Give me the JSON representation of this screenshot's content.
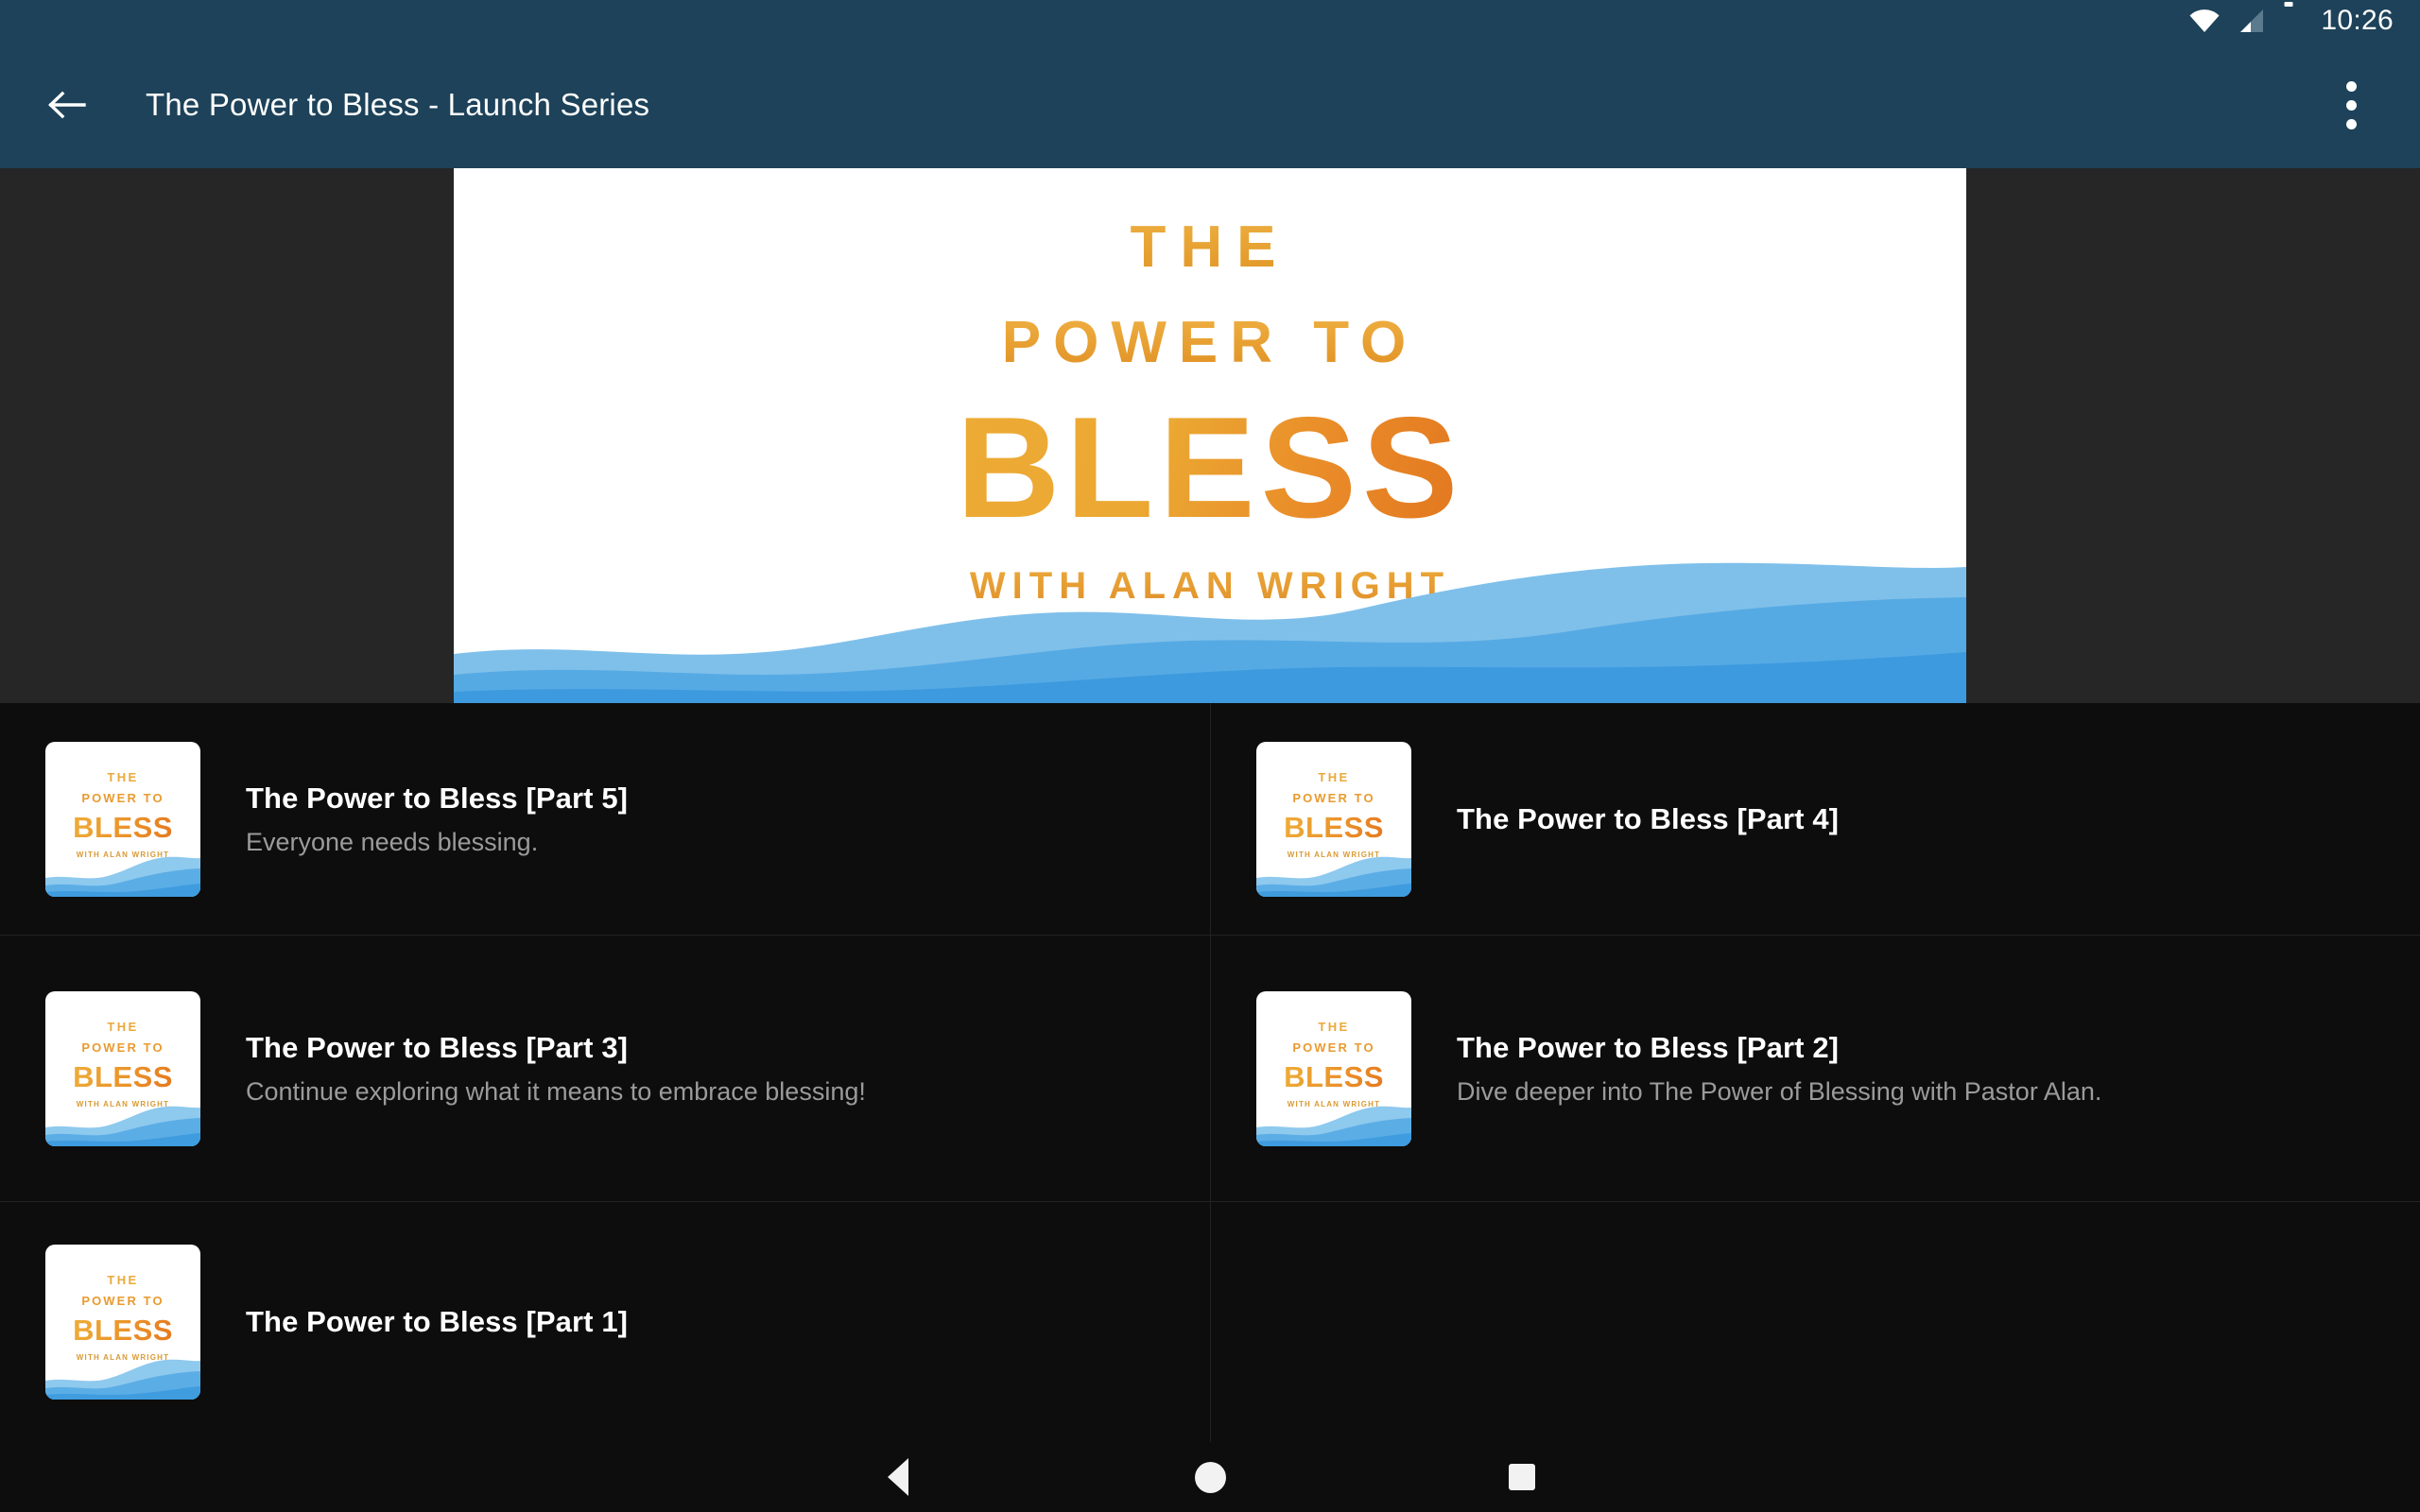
{
  "status_bar": {
    "time": "10:26",
    "icons": [
      "wifi-icon",
      "cellular-signal-icon",
      "battery-icon"
    ]
  },
  "app_bar": {
    "back_icon": "back-arrow-icon",
    "title": "The Power to Bless - Launch Series",
    "overflow_icon": "more-vertical-icon",
    "background_color": "#1d4259"
  },
  "hero": {
    "line1": "THE",
    "line2": "POWER TO",
    "line3": "BLESS",
    "line4": "WITH ALAN WRIGHT",
    "accent_color": "#e89a2c",
    "wave_color": "#4aa3e0",
    "background_color": "#ffffff"
  },
  "thumbnail": {
    "line1": "THE",
    "line2": "POWER TO",
    "line3": "BLESS",
    "line4": "WITH ALAN WRIGHT"
  },
  "episodes": [
    {
      "title": "The Power to Bless [Part 5]",
      "subtitle": "Everyone needs blessing."
    },
    {
      "title": "The Power to Bless [Part 4]",
      "subtitle": ""
    },
    {
      "title": "The Power to Bless [Part 3]",
      "subtitle": "Continue exploring what it means to embrace blessing!"
    },
    {
      "title": "The Power to Bless [Part 2]",
      "subtitle": "Dive deeper into The Power of Blessing with Pastor Alan."
    },
    {
      "title": "The Power to Bless [Part 1]",
      "subtitle": ""
    }
  ],
  "nav_bar": {
    "back": "nav-back-icon",
    "home": "nav-home-icon",
    "recents": "nav-recents-icon"
  }
}
